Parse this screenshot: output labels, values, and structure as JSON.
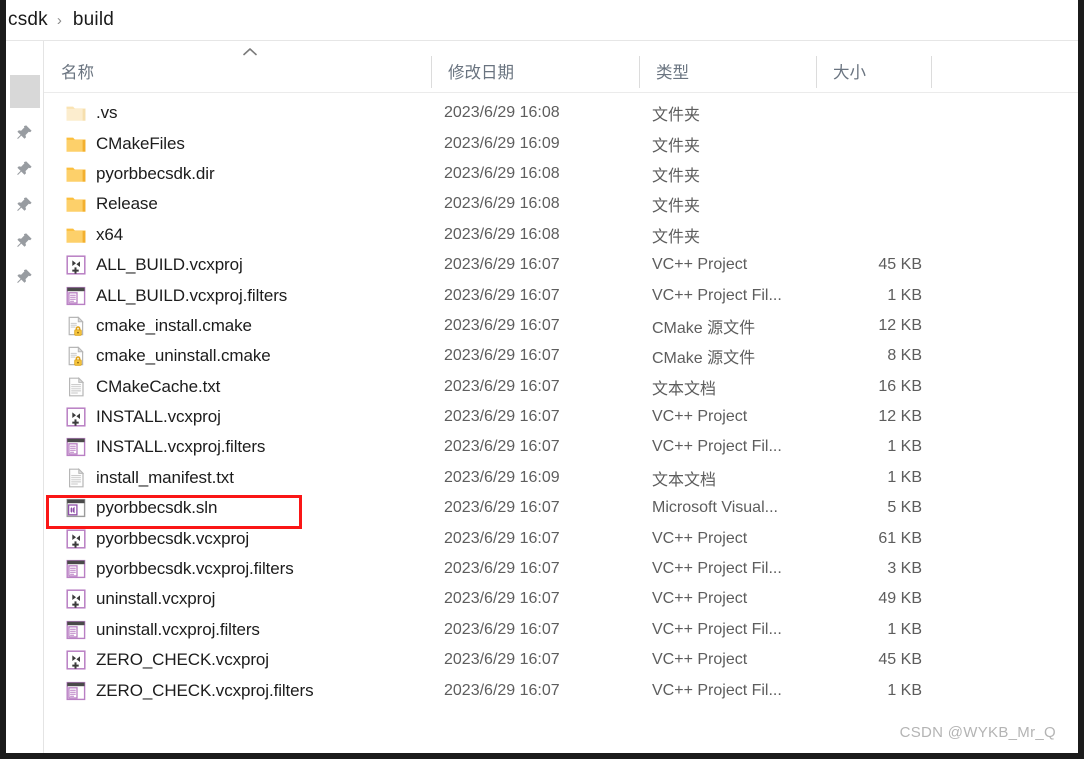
{
  "window": {
    "frame_color": "#1b1b1b"
  },
  "addressbar": {
    "crumbs": [
      "csdk",
      "build"
    ],
    "separator": "›"
  },
  "nav_pane": {
    "pin_icon_name": "pin-icon",
    "pin_count": 5
  },
  "columns": [
    {
      "key": "name",
      "label": "名称"
    },
    {
      "key": "date",
      "label": "修改日期"
    },
    {
      "key": "type",
      "label": "类型"
    },
    {
      "key": "size",
      "label": "大小"
    }
  ],
  "sort": {
    "column": "name",
    "direction": "ascending",
    "icon": "chevron-up-icon"
  },
  "highlight": {
    "target_row": "pyorbbecsdk.sln",
    "color": "#fa1616"
  },
  "watermark": {
    "text": "CSDN @WYKB_Mr_Q"
  },
  "rows": [
    {
      "name": ".vs",
      "icon": "folder-faded-icon",
      "date": "2023/6/29 16:08",
      "type": "文件夹",
      "size": ""
    },
    {
      "name": "CMakeFiles",
      "icon": "folder-icon",
      "date": "2023/6/29 16:09",
      "type": "文件夹",
      "size": ""
    },
    {
      "name": "pyorbbecsdk.dir",
      "icon": "folder-icon",
      "date": "2023/6/29 16:08",
      "type": "文件夹",
      "size": ""
    },
    {
      "name": "Release",
      "icon": "folder-icon",
      "date": "2023/6/29 16:08",
      "type": "文件夹",
      "size": ""
    },
    {
      "name": "x64",
      "icon": "folder-icon",
      "date": "2023/6/29 16:08",
      "type": "文件夹",
      "size": ""
    },
    {
      "name": "ALL_BUILD.vcxproj",
      "icon": "vcxproj-icon",
      "date": "2023/6/29 16:07",
      "type": "VC++ Project",
      "size": "45 KB"
    },
    {
      "name": "ALL_BUILD.vcxproj.filters",
      "icon": "filters-icon",
      "date": "2023/6/29 16:07",
      "type": "VC++ Project Fil...",
      "size": "1 KB"
    },
    {
      "name": "cmake_install.cmake",
      "icon": "cmake-lock-icon",
      "date": "2023/6/29 16:07",
      "type": "CMake 源文件",
      "size": "12 KB"
    },
    {
      "name": "cmake_uninstall.cmake",
      "icon": "cmake-lock-icon",
      "date": "2023/6/29 16:07",
      "type": "CMake 源文件",
      "size": "8 KB"
    },
    {
      "name": "CMakeCache.txt",
      "icon": "text-file-icon",
      "date": "2023/6/29 16:07",
      "type": "文本文档",
      "size": "16 KB"
    },
    {
      "name": "INSTALL.vcxproj",
      "icon": "vcxproj-icon",
      "date": "2023/6/29 16:07",
      "type": "VC++ Project",
      "size": "12 KB"
    },
    {
      "name": "INSTALL.vcxproj.filters",
      "icon": "filters-icon",
      "date": "2023/6/29 16:07",
      "type": "VC++ Project Fil...",
      "size": "1 KB"
    },
    {
      "name": "install_manifest.txt",
      "icon": "text-file-icon",
      "date": "2023/6/29 16:09",
      "type": "文本文档",
      "size": "1 KB"
    },
    {
      "name": "pyorbbecsdk.sln",
      "icon": "sln-icon",
      "date": "2023/6/29 16:07",
      "type": "Microsoft Visual...",
      "size": "5 KB"
    },
    {
      "name": "pyorbbecsdk.vcxproj",
      "icon": "vcxproj-icon",
      "date": "2023/6/29 16:07",
      "type": "VC++ Project",
      "size": "61 KB"
    },
    {
      "name": "pyorbbecsdk.vcxproj.filters",
      "icon": "filters-icon",
      "date": "2023/6/29 16:07",
      "type": "VC++ Project Fil...",
      "size": "3 KB"
    },
    {
      "name": "uninstall.vcxproj",
      "icon": "vcxproj-icon",
      "date": "2023/6/29 16:07",
      "type": "VC++ Project",
      "size": "49 KB"
    },
    {
      "name": "uninstall.vcxproj.filters",
      "icon": "filters-icon",
      "date": "2023/6/29 16:07",
      "type": "VC++ Project Fil...",
      "size": "1 KB"
    },
    {
      "name": "ZERO_CHECK.vcxproj",
      "icon": "vcxproj-icon",
      "date": "2023/6/29 16:07",
      "type": "VC++ Project",
      "size": "45 KB"
    },
    {
      "name": "ZERO_CHECK.vcxproj.filters",
      "icon": "filters-icon",
      "date": "2023/6/29 16:07",
      "type": "VC++ Project Fil...",
      "size": "1 KB"
    }
  ]
}
